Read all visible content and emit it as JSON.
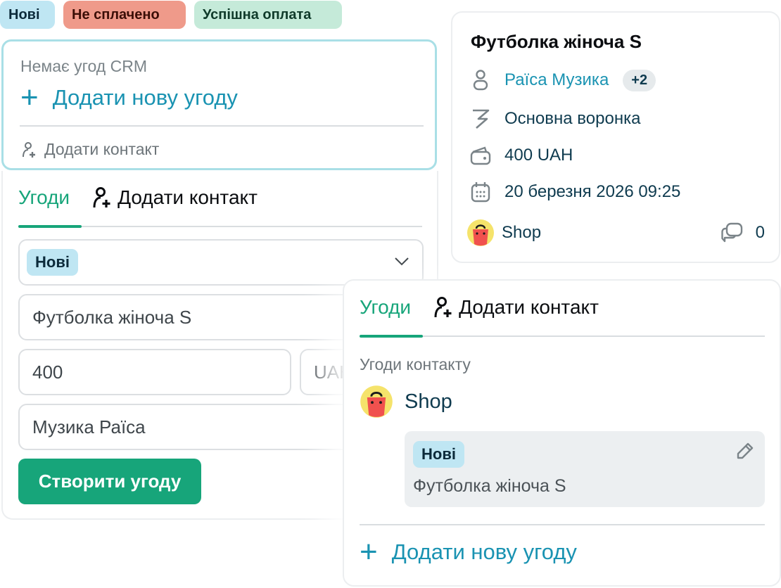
{
  "badges": {
    "new": "Нові",
    "unpaid": "Не сплачено",
    "success": "Успішна оплата"
  },
  "empty_card": {
    "note": "Немає угод CRM",
    "add_deal": "Додати нову угоду",
    "add_contact": "Додати контакт"
  },
  "form": {
    "tab_deals": "Угоди",
    "tab_add_contact": "Додати контакт",
    "stage": "Нові",
    "title_value": "Футболка жіноча S",
    "amount_value": "400",
    "currency_value": "UAH",
    "contact_value": "Музика Раїса",
    "create_button": "Створити угоду"
  },
  "info": {
    "title": "Футболка жіноча S",
    "contact_name": "Раїса Музика",
    "more_contacts": "+2",
    "pipeline": "Основна воронка",
    "amount": "400 UAH",
    "date": "20 березня 2026 09:25",
    "source": "Shop",
    "comments_count": "0"
  },
  "contact_panel": {
    "tab_deals": "Угоди",
    "tab_add_contact": "Додати контакт",
    "deals_label": "Угоди контакту",
    "shop_name": "Shop",
    "deal_stage": "Нові",
    "deal_title": "Футболка жіноча S",
    "add_deal": "Додати нову угоду"
  },
  "colors": {
    "accent_green": "#17a57a",
    "accent_blue": "#1a93b2",
    "badge_new": "#bfe6f3",
    "badge_unpaid": "#ef9a8a",
    "badge_success": "#c5ead9"
  }
}
